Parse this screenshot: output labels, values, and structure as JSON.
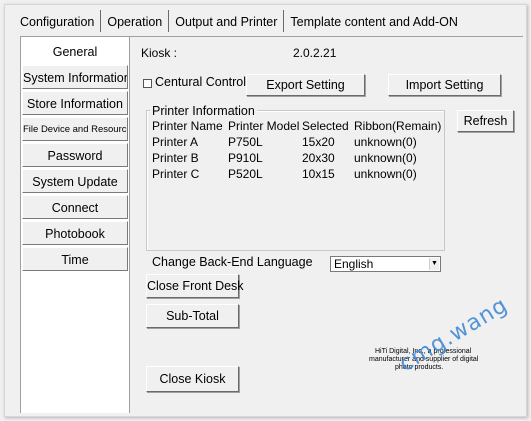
{
  "tabs": [
    {
      "label": "Configuration"
    },
    {
      "label": "Operation"
    },
    {
      "label": "Output and Printer"
    },
    {
      "label": "Template content and Add-ON"
    }
  ],
  "sidebar": {
    "items": [
      {
        "label": "General"
      },
      {
        "label": "System Information"
      },
      {
        "label": "Store Information"
      },
      {
        "label": "File Device and Resource"
      },
      {
        "label": "Password"
      },
      {
        "label": "System Update"
      },
      {
        "label": "Connect"
      },
      {
        "label": "Photobook"
      },
      {
        "label": "Time"
      }
    ]
  },
  "general": {
    "kiosk_label": "Kiosk :",
    "kiosk_version": "2.0.2.21",
    "central_control_label": "Centural Control",
    "export_button": "Export Setting",
    "import_button": "Import Setting",
    "refresh_button": "Refresh",
    "printer_info": {
      "title": "Printer Information",
      "columns": [
        "Printer Name",
        "Printer Model",
        "Selected",
        "Ribbon(Remain)"
      ],
      "rows": [
        [
          "Printer A",
          "P750L",
          "15x20",
          "unknown(0)"
        ],
        [
          "Printer B",
          "P910L",
          "20x30",
          "unknown(0)"
        ],
        [
          "Printer C",
          "P520L",
          "10x15",
          "unknown(0)"
        ]
      ]
    },
    "language_label": "Change Back-End Language",
    "language_value": "English",
    "close_front_desk_button": "Close Front Desk",
    "subtotal_button": "Sub-Total",
    "close_kiosk_button": "Close Kiosk",
    "footer_lines": [
      "HiTi Digital, Inc., a professional",
      "manufacturer and supplier of digital",
      "photo products."
    ]
  },
  "watermark": "cmg.wang"
}
